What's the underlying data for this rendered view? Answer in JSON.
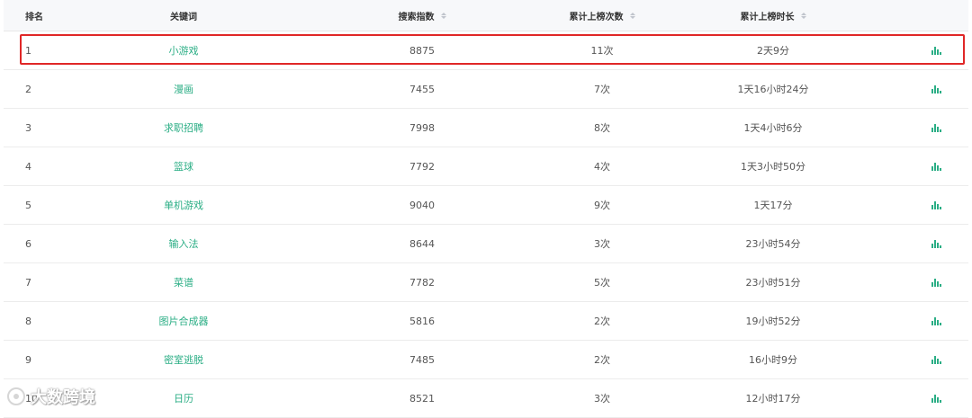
{
  "table": {
    "headers": {
      "rank": "排名",
      "keyword": "关键词",
      "index": "搜索指数",
      "times": "累计上榜次数",
      "duration": "累计上榜时长"
    },
    "rows": [
      {
        "rank": "1",
        "keyword": "小游戏",
        "index": "8875",
        "times": "11次",
        "duration": "2天9分"
      },
      {
        "rank": "2",
        "keyword": "漫画",
        "index": "7455",
        "times": "7次",
        "duration": "1天16小时24分"
      },
      {
        "rank": "3",
        "keyword": "求职招聘",
        "index": "7998",
        "times": "8次",
        "duration": "1天4小时6分"
      },
      {
        "rank": "4",
        "keyword": "篮球",
        "index": "7792",
        "times": "4次",
        "duration": "1天3小时50分"
      },
      {
        "rank": "5",
        "keyword": "单机游戏",
        "index": "9040",
        "times": "9次",
        "duration": "1天17分"
      },
      {
        "rank": "6",
        "keyword": "输入法",
        "index": "8644",
        "times": "3次",
        "duration": "23小时54分"
      },
      {
        "rank": "7",
        "keyword": "菜谱",
        "index": "7782",
        "times": "5次",
        "duration": "23小时51分"
      },
      {
        "rank": "8",
        "keyword": "图片合成器",
        "index": "5816",
        "times": "2次",
        "duration": "19小时52分"
      },
      {
        "rank": "9",
        "keyword": "密室逃脱",
        "index": "7485",
        "times": "2次",
        "duration": "16小时9分"
      },
      {
        "rank": "10",
        "keyword": "日历",
        "index": "8521",
        "times": "3次",
        "duration": "12小时17分"
      }
    ],
    "highlighted_rank": "1",
    "action_icon": "bar-chart-icon",
    "sort_icon": "sort-icon"
  },
  "watermark": {
    "text": "大数跨境"
  },
  "colors": {
    "keyword": "#2bae85",
    "highlight_border": "#e02727",
    "header_bg": "#f7f8fa"
  }
}
